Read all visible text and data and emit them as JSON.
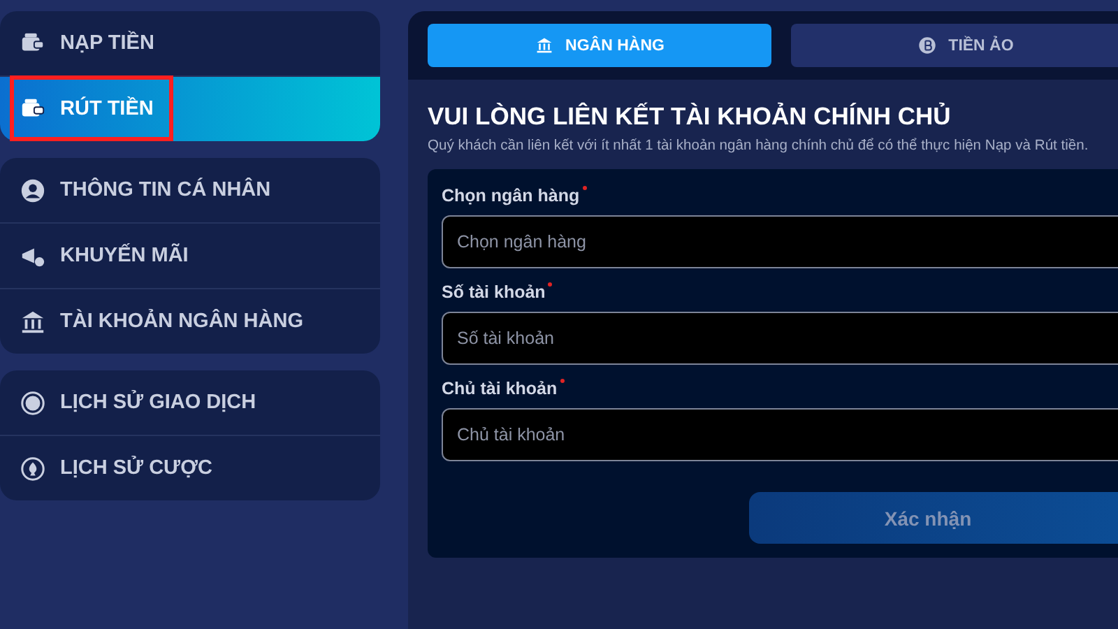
{
  "sidebar": {
    "groups": [
      {
        "items": [
          {
            "label": "NẠP TIỀN",
            "selected": false,
            "highlighted": false
          },
          {
            "label": "RÚT TIỀN",
            "selected": true,
            "highlighted": true
          }
        ]
      },
      {
        "items": [
          {
            "label": "THÔNG TIN CÁ NHÂN",
            "selected": false,
            "highlighted": false
          },
          {
            "label": "KHUYẾN MÃI",
            "selected": false,
            "highlighted": false
          },
          {
            "label": "TÀI KHOẢN NGÂN HÀNG",
            "selected": false,
            "highlighted": false
          }
        ]
      },
      {
        "items": [
          {
            "label": "LỊCH SỬ GIAO DỊCH",
            "selected": false,
            "highlighted": false
          },
          {
            "label": "LỊCH SỬ CƯỢC",
            "selected": false,
            "highlighted": false
          }
        ]
      }
    ]
  },
  "tabs": [
    {
      "label": "NGÂN HÀNG",
      "selected": true
    },
    {
      "label": "TIỀN ẢO",
      "selected": false
    }
  ],
  "form": {
    "title": "VUI LÒNG LIÊN KẾT TÀI KHOẢN CHÍNH CHỦ",
    "description": "Quý khách cần liên kết với ít nhất 1 tài khoản ngân hàng chính chủ để có thể thực hiện Nạp và Rút tiền.",
    "fields": [
      {
        "label": "Chọn ngân hàng",
        "required": true,
        "placeholder": "Chọn ngân hàng"
      },
      {
        "label": "Số tài khoản",
        "required": true,
        "placeholder": "Số tài khoản"
      },
      {
        "label": "Chủ tài khoản",
        "required": true,
        "placeholder": "Chủ tài khoản"
      }
    ],
    "submit": {
      "label": "Xác nhận",
      "disabled": true
    }
  }
}
